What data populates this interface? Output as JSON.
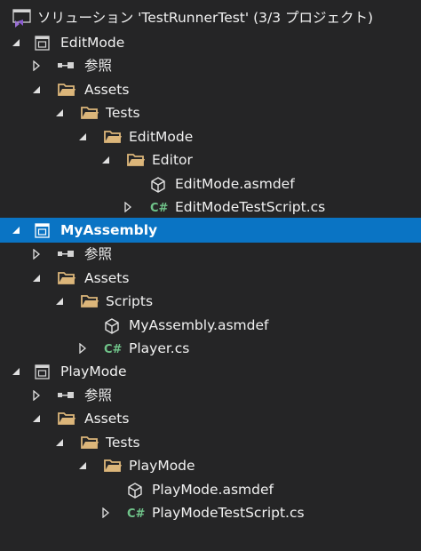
{
  "solution": {
    "label": "ソリューション 'TestRunnerTest' (3/3 プロジェクト)",
    "icon": "visual-studio-solution-icon"
  },
  "colors": {
    "background": "#252526",
    "selection": "#0a74c4",
    "folder": "#dcb67a",
    "csharp": "#70c48a",
    "text": "#f1f1f1"
  },
  "projects": [
    {
      "name": "EditMode",
      "references": "参照",
      "assets": "Assets",
      "folder1": "Tests",
      "folder2": "EditMode",
      "folder3": "Editor",
      "asmdef": "EditMode.asmdef",
      "script": "EditModeTestScript.cs"
    },
    {
      "name": "MyAssembly",
      "references": "参照",
      "assets": "Assets",
      "folder1": "Scripts",
      "asmdef": "MyAssembly.asmdef",
      "script": "Player.cs"
    },
    {
      "name": "PlayMode",
      "references": "参照",
      "assets": "Assets",
      "folder1": "Tests",
      "folder2": "PlayMode",
      "asmdef": "PlayMode.asmdef",
      "script": "PlayModeTestScript.cs"
    }
  ]
}
